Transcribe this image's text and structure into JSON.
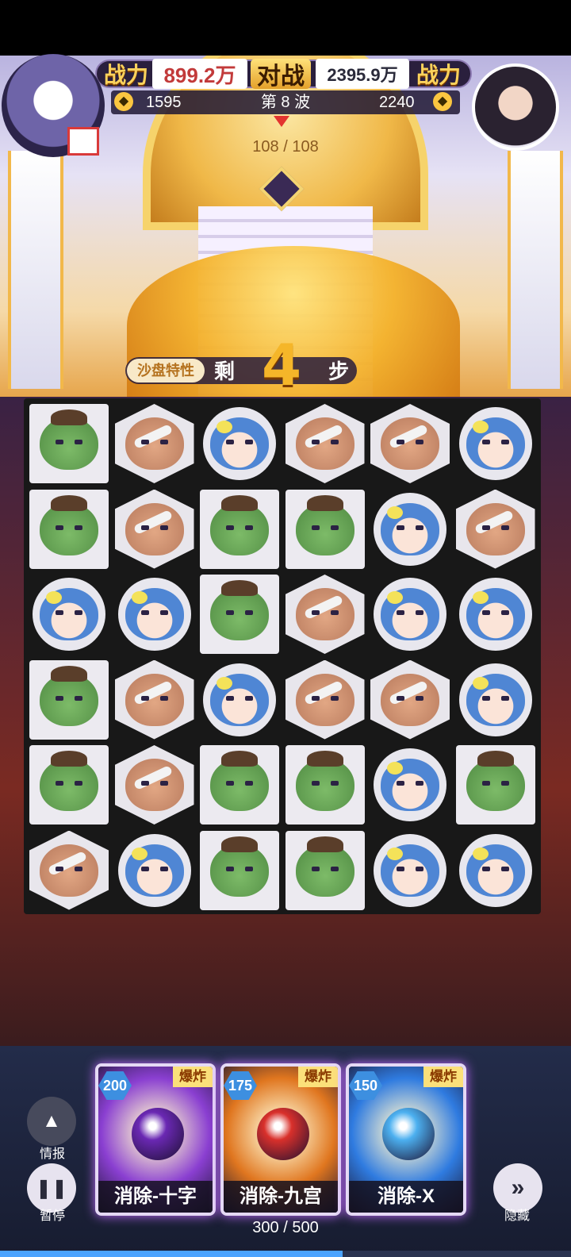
{
  "header": {
    "power_label_left": "战力",
    "power_value_left": "899.2万",
    "vs_label": "对战",
    "power_value_right": "2395.9万",
    "power_label_right": "战力",
    "gems_left": "1595",
    "wave": "第 8 波",
    "gems_right": "2240",
    "boss_hp": "108 / 108"
  },
  "steps": {
    "tag": "沙盘特性",
    "prefix": "剩",
    "count": "4",
    "suffix": "步"
  },
  "board": {
    "rows": [
      [
        {
          "tile": "orc",
          "shape": "square"
        },
        {
          "tile": "ogre",
          "shape": "hex"
        },
        {
          "tile": "girl",
          "shape": "circle"
        },
        {
          "tile": "ogre",
          "shape": "hex"
        },
        {
          "tile": "ogre",
          "shape": "hex"
        },
        {
          "tile": "girl",
          "shape": "circle"
        }
      ],
      [
        {
          "tile": "orc",
          "shape": "square"
        },
        {
          "tile": "ogre",
          "shape": "hex"
        },
        {
          "tile": "orc",
          "shape": "square"
        },
        {
          "tile": "orc",
          "shape": "square"
        },
        {
          "tile": "girl",
          "shape": "circle"
        },
        {
          "tile": "ogre",
          "shape": "hex"
        }
      ],
      [
        {
          "tile": "girl",
          "shape": "circle"
        },
        {
          "tile": "girl",
          "shape": "circle"
        },
        {
          "tile": "orc",
          "shape": "square"
        },
        {
          "tile": "ogre",
          "shape": "hex"
        },
        {
          "tile": "girl",
          "shape": "circle"
        },
        {
          "tile": "girl",
          "shape": "circle"
        }
      ],
      [
        {
          "tile": "orc",
          "shape": "square"
        },
        {
          "tile": "ogre",
          "shape": "hex"
        },
        {
          "tile": "girl",
          "shape": "circle"
        },
        {
          "tile": "ogre",
          "shape": "hex"
        },
        {
          "tile": "ogre",
          "shape": "hex"
        },
        {
          "tile": "girl",
          "shape": "circle"
        }
      ],
      [
        {
          "tile": "orc",
          "shape": "square"
        },
        {
          "tile": "ogre",
          "shape": "hex"
        },
        {
          "tile": "orc",
          "shape": "square"
        },
        {
          "tile": "orc",
          "shape": "square"
        },
        {
          "tile": "girl",
          "shape": "circle"
        },
        {
          "tile": "orc",
          "shape": "square"
        }
      ],
      [
        {
          "tile": "ogre",
          "shape": "hex"
        },
        {
          "tile": "girl",
          "shape": "circle"
        },
        {
          "tile": "orc",
          "shape": "square"
        },
        {
          "tile": "orc",
          "shape": "square"
        },
        {
          "tile": "girl",
          "shape": "circle"
        },
        {
          "tile": "girl",
          "shape": "circle"
        }
      ]
    ]
  },
  "skills": [
    {
      "cost": "200",
      "tag": "爆炸",
      "name": "消除-十字",
      "color": "#8a3fd1",
      "bomb": "#6a28b3"
    },
    {
      "cost": "175",
      "tag": "爆炸",
      "name": "消除-九宫",
      "color": "#e0761f",
      "bomb": "#d9302b"
    },
    {
      "cost": "150",
      "tag": "爆炸",
      "name": "消除-X",
      "color": "#2f7be0",
      "bomb": "#4cb0f0"
    }
  ],
  "controls": {
    "info_label": "情报",
    "pause_label": "暂停",
    "hide_label": "隐藏"
  },
  "energy": {
    "text": "300 / 500",
    "fraction": 0.6
  }
}
